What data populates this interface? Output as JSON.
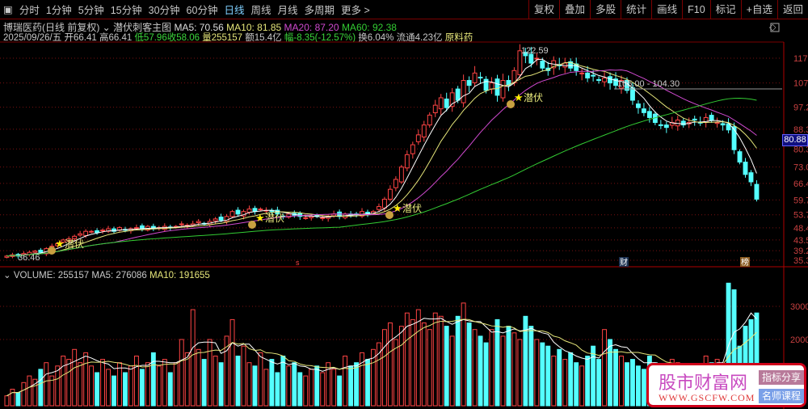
{
  "toolbar": {
    "tabs": [
      "分时",
      "1分钟",
      "5分钟",
      "15分钟",
      "30分钟",
      "60分钟",
      "日线",
      "周线",
      "月线",
      "多周期",
      "更多 >"
    ],
    "active": "日线",
    "right": [
      "复权",
      "叠加",
      "多股",
      "统计",
      "画线",
      "F10",
      "标记",
      "+自选",
      "返回"
    ]
  },
  "stock": {
    "name": "博瑞医药(日线 前复权)",
    "indicator": "潜伏刺客主图",
    "ma5": "MA5: 70.56",
    "ma10": "MA10: 81.85",
    "ma20": "MA20: 87.20",
    "ma60": "MA60: 92.38",
    "date": "2025/09/26/五",
    "open": "开66.41",
    "high": "高66.41",
    "low": "低57.96",
    "close": "收58.06",
    "vol": "量255157",
    "amount": "额15.4亿",
    "change": "幅-8.35(-12.57%)",
    "turnover": "换6.04%",
    "float": "流通4.23亿",
    "sector": "原料药"
  },
  "price_axis": [
    "117",
    "107",
    "97.2",
    "88.3",
    "80.3",
    "73.0",
    "66.4",
    "59.7",
    "53.7",
    "48.4",
    "43.5",
    "39.2",
    "35.3"
  ],
  "current_price": "80.88",
  "annotations": {
    "high": "122.59",
    "low": "36.46",
    "range": "105.00 - 104.30",
    "signal": "潜伏",
    "cai": "财",
    "bang": "榜",
    "s": "s"
  },
  "volume": {
    "label": "VOLUME: 255157",
    "ma5": "MA5: 276086",
    "ma10": "MA10: 191655",
    "axis": [
      "3000",
      "2000"
    ]
  },
  "colors": {
    "up": "#ff4444",
    "down": "#54ffff",
    "ma5": "#ffffff",
    "ma10": "#e6e67a",
    "ma20": "#d04ad0",
    "ma60": "#33cc33"
  },
  "closes": [
    37,
    37.5,
    37,
    38,
    38.5,
    39,
    38.5,
    40,
    41,
    42,
    43.5,
    44,
    45,
    46,
    47,
    47,
    46.5,
    47.5,
    48,
    47,
    48.5,
    47.5,
    48,
    48.5,
    48,
    49,
    48,
    48.5,
    49,
    48.5,
    49,
    50,
    49.5,
    50,
    51,
    50,
    51,
    52,
    51.5,
    53,
    55,
    54,
    55,
    56,
    55,
    56,
    55.5,
    55,
    54,
    53,
    54,
    53.5,
    53,
    52.5,
    53,
    53,
    52.5,
    53,
    54,
    53,
    54,
    53.5,
    54,
    55,
    54,
    55,
    57,
    60,
    64,
    68,
    73,
    78,
    82,
    86,
    90,
    94,
    98,
    101,
    97,
    103,
    100,
    108,
    106,
    111,
    109,
    104,
    107,
    102,
    108,
    106,
    112,
    120,
    118,
    115,
    117,
    113,
    112,
    116,
    114,
    115,
    113,
    112,
    111,
    109,
    110,
    108,
    109,
    107,
    106,
    108,
    104,
    100,
    97,
    95,
    93,
    91,
    90,
    89,
    91,
    92,
    90,
    91,
    92,
    91,
    93,
    92,
    91,
    90,
    88,
    80,
    75,
    70,
    67,
    60
  ],
  "volumes": [
    300,
    500,
    400,
    700,
    900,
    800,
    1100,
    1300,
    900,
    1200,
    1500,
    1400,
    1700,
    1300,
    1600,
    1200,
    1000,
    1400,
    1100,
    900,
    1300,
    1000,
    1200,
    1500,
    1100,
    1300,
    1600,
    1200,
    1400,
    1000,
    1300,
    2000,
    1600,
    2900,
    1700,
    1400,
    2000,
    1500,
    1300,
    2100,
    2600,
    1500,
    1800,
    1300,
    1200,
    1600,
    1100,
    1400,
    1000,
    1500,
    1200,
    1300,
    1000,
    900,
    1100,
    1200,
    1000,
    1300,
    1100,
    900,
    1500,
    1200,
    1300,
    1600,
    1400,
    1700,
    1900,
    2300,
    2500,
    2000,
    2400,
    2800,
    2600,
    2900,
    2500,
    2300,
    2800,
    2700,
    2400,
    2100,
    2700,
    3100,
    2500,
    2300,
    2100,
    1900,
    2300,
    2600,
    2100,
    2400,
    2200,
    2000,
    2700,
    2400,
    2000,
    1900,
    1800,
    1500,
    1700,
    1400,
    1600,
    1300,
    1200,
    1500,
    1800,
    1400,
    2300,
    2000,
    1700,
    1500,
    1300,
    1400,
    1200,
    1100,
    1500,
    1300,
    1200,
    1000,
    1400,
    1300,
    1100,
    1000,
    1200,
    1100,
    1500,
    1300,
    1400,
    1200,
    3700,
    3500,
    1800,
    2400,
    2600,
    2800
  ]
}
